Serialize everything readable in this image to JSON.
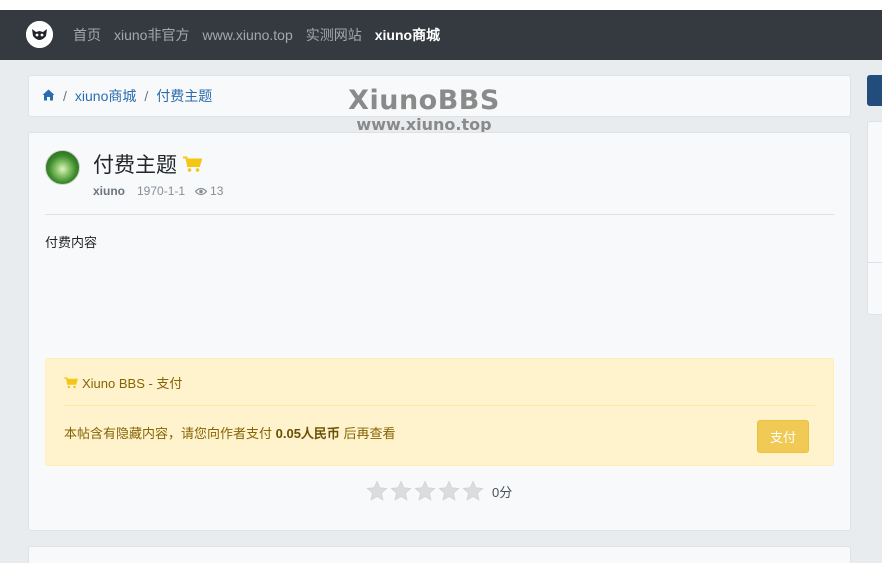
{
  "nav": {
    "links": [
      "首页",
      "xiuno非官方",
      "www.xiuno.top",
      "实测网站",
      "xiuno商城"
    ],
    "active_index": 4
  },
  "breadcrumb": {
    "home_icon": "home-icon",
    "items": [
      "xiuno商城",
      "付费主题"
    ]
  },
  "watermark": {
    "title": "XiunoBBS",
    "url": "www.xiuno.top"
  },
  "post": {
    "title": "付费主题",
    "title_icon": "shopping-cart-icon",
    "author": "xiuno",
    "date": "1970-1-1",
    "views": "13",
    "body": "付费内容"
  },
  "pay": {
    "header": "Xiuno BBS - 支付",
    "text_before": "本帖含有隐藏内容，请您向作者支付 ",
    "amount": "0.05人民币",
    "text_after": " 后再查看",
    "button": "支付"
  },
  "rating": {
    "stars": 5,
    "filled": 0,
    "score": "0分"
  },
  "colors": {
    "navbar": "#343a40",
    "link": "#2b6cb0",
    "pay_bg": "#fff3cd",
    "pay_button": "#f0ca55",
    "cart_icon": "#f5c518",
    "sidebar_button": "#214c7c"
  }
}
